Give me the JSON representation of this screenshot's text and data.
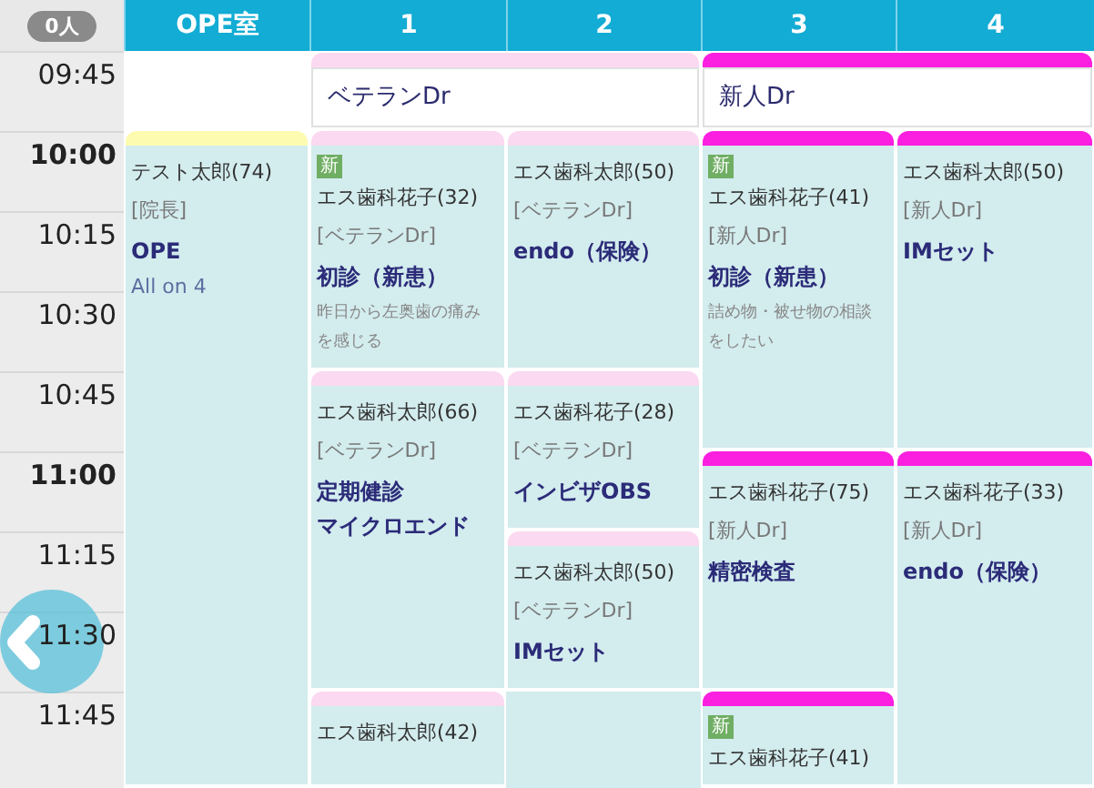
{
  "staff_count": "0人",
  "columns": [
    "OPE室",
    "1",
    "2",
    "3",
    "4"
  ],
  "rows": [
    {
      "time": "09:45",
      "hour": false,
      "cells": [
        {
          "kind": "empty"
        },
        {
          "kind": "doctor_block",
          "wide": true,
          "color": "#fbd9f1",
          "doctor": "ベテランDr"
        },
        {
          "kind": "covered"
        },
        {
          "kind": "doctor_block",
          "wide": true,
          "color": "#fb1fe0",
          "doctor": "新人Dr"
        },
        {
          "kind": "covered"
        }
      ]
    },
    {
      "time": "10:00",
      "hour": true,
      "cells": [
        {
          "kind": "appointment",
          "color": "#fdfbb0",
          "new": false,
          "patient": "テスト太郎(74)",
          "doctor": "[院長]",
          "treatments": [
            "OPE"
          ],
          "memo": {
            "kind": "plan",
            "text": "All on 4"
          }
        },
        {
          "kind": "appointment",
          "color": "#fbd9f1",
          "new": true,
          "new_label": "新",
          "patient": "エス歯科花子(32)",
          "doctor": "[ベテランDr]",
          "treatments": [
            "初診（新患）"
          ],
          "memo": {
            "kind": "note",
            "text": "昨日から左奥歯の痛みを感じる"
          }
        },
        {
          "kind": "appointment",
          "color": "#fbd9f1",
          "new": false,
          "patient": "エス歯科太郎(50)",
          "doctor": "[ベテランDr]",
          "treatments": [
            "endo（保険）"
          ]
        },
        {
          "kind": "appointment",
          "color": "#fb1fe0",
          "new": true,
          "new_label": "新",
          "patient": "エス歯科花子(41)",
          "doctor": "[新人Dr]",
          "treatments": [
            "初診（新患）"
          ],
          "memo": {
            "kind": "note",
            "text": "詰め物・被せ物の相談をしたい"
          }
        },
        {
          "kind": "appointment",
          "color": "#fb1fe0",
          "new": false,
          "patient": "エス歯科太郎(50)",
          "doctor": "[新人Dr]",
          "treatments": [
            "IMセット"
          ]
        }
      ]
    },
    {
      "time": "10:15",
      "hour": false,
      "cells": [
        {
          "kind": "continued"
        },
        {
          "kind": "continued"
        },
        {
          "kind": "continued"
        },
        {
          "kind": "continued"
        },
        {
          "kind": "continued"
        }
      ]
    },
    {
      "time": "10:30",
      "hour": false,
      "cells": [
        {
          "kind": "continued"
        },
        {
          "kind": "continued"
        },
        {
          "kind": "continued"
        },
        {
          "kind": "continued"
        },
        {
          "kind": "continued"
        }
      ]
    },
    {
      "time": "10:45",
      "hour": false,
      "cells": [
        {
          "kind": "continued"
        },
        {
          "kind": "appointment",
          "color": "#fbd9f1",
          "new": false,
          "patient": "エス歯科太郎(66)",
          "doctor": "[ベテランDr]",
          "treatments": [
            "定期健診",
            "マイクロエンド"
          ]
        },
        {
          "kind": "appointment",
          "color": "#fbd9f1",
          "new": false,
          "patient": "エス歯科花子(28)",
          "doctor": "[ベテランDr]",
          "treatments": [
            "インビザOBS"
          ]
        },
        {
          "kind": "continued"
        },
        {
          "kind": "continued"
        }
      ]
    },
    {
      "time": "11:00",
      "hour": true,
      "cells": [
        {
          "kind": "continued"
        },
        {
          "kind": "continued"
        },
        {
          "kind": "continued"
        },
        {
          "kind": "appointment",
          "color": "#fb1fe0",
          "new": false,
          "patient": "エス歯科花子(75)",
          "doctor": "[新人Dr]",
          "treatments": [
            "精密検査"
          ]
        },
        {
          "kind": "appointment",
          "color": "#fb1fe0",
          "new": false,
          "patient": "エス歯科花子(33)",
          "doctor": "[新人Dr]",
          "treatments": [
            "endo（保険）"
          ]
        }
      ]
    },
    {
      "time": "11:15",
      "hour": false,
      "cells": [
        {
          "kind": "continued"
        },
        {
          "kind": "continued"
        },
        {
          "kind": "appointment",
          "color": "#fbd9f1",
          "new": false,
          "patient": "エス歯科太郎(50)",
          "doctor": "[ベテランDr]",
          "treatments": [
            "IMセット"
          ]
        },
        {
          "kind": "continued"
        },
        {
          "kind": "continued"
        }
      ]
    },
    {
      "time": "11:30",
      "hour": false,
      "cells": [
        {
          "kind": "continued"
        },
        {
          "kind": "continued"
        },
        {
          "kind": "continued"
        },
        {
          "kind": "continued"
        },
        {
          "kind": "continued"
        }
      ]
    },
    {
      "time": "11:45",
      "hour": false,
      "cells": [
        {
          "kind": "continued"
        },
        {
          "kind": "appointment",
          "color": "#fbd9f1",
          "new": false,
          "patient": "エス歯科太郎(42)"
        },
        {
          "kind": "empty"
        },
        {
          "kind": "appointment",
          "color": "#fb1fe0",
          "new": true,
          "new_label": "新",
          "patient": "エス歯科花子(41)"
        },
        {
          "kind": "continued"
        }
      ]
    }
  ]
}
